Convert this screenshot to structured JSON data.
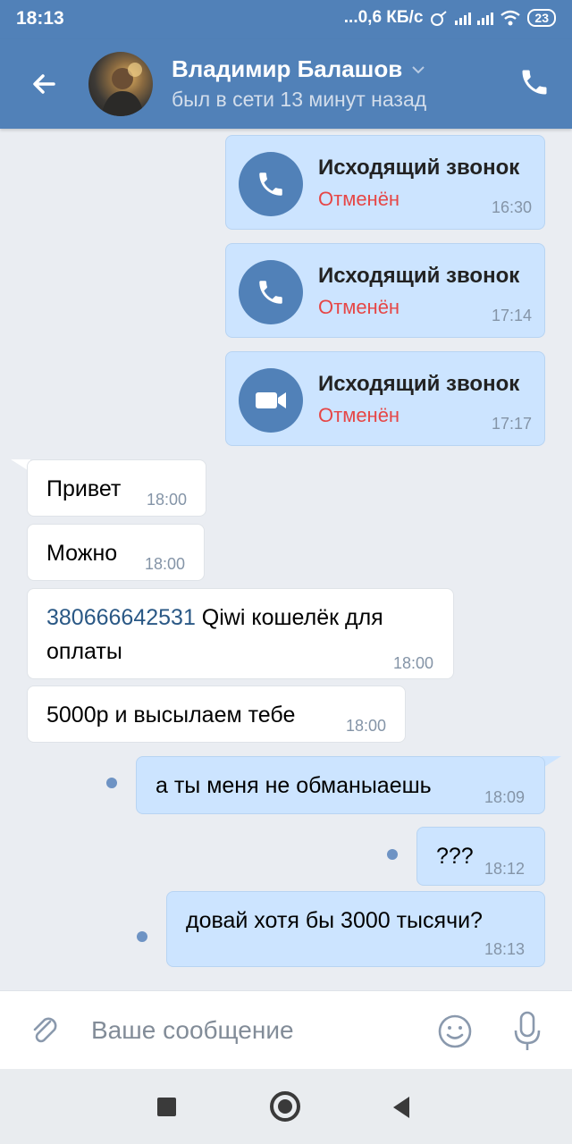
{
  "status_bar": {
    "time": "18:13",
    "network_speed": "...0,6 КБ/с",
    "battery": "23"
  },
  "header": {
    "name": "Владимир Балашов",
    "status": "был в сети 13 минут назад"
  },
  "calls": [
    {
      "title": "Исходящий звонок",
      "status": "Отменён",
      "time": "16:30",
      "icon": "phone-icon"
    },
    {
      "title": "Исходящий звонок",
      "status": "Отменён",
      "time": "17:14",
      "icon": "phone-icon"
    },
    {
      "title": "Исходящий звонок",
      "status": "Отменён",
      "time": "17:17",
      "icon": "video-camera-icon"
    }
  ],
  "messages": [
    {
      "dir": "in",
      "text": "Привет",
      "time": "18:00"
    },
    {
      "dir": "in",
      "text": "Можно",
      "time": "18:00"
    },
    {
      "dir": "in",
      "link": "380666642531",
      "text": " Qiwi кошелёк для",
      "text2": "оплаты",
      "time": "18:00"
    },
    {
      "dir": "in",
      "text": "5000р и высылаем тебе",
      "time": "18:00"
    },
    {
      "dir": "out",
      "text": "а ты меня не обманыаешь",
      "time": "18:09"
    },
    {
      "dir": "out",
      "text": "???",
      "time": "18:12"
    },
    {
      "dir": "out",
      "text": "довай хотя бы 3000 тысячи?",
      "time": "18:13"
    }
  ],
  "composer": {
    "placeholder": "Ваше сообщение"
  },
  "colors": {
    "accent": "#5181b8",
    "outgoing_bubble": "#cce4ff",
    "cancelled": "#e64646"
  }
}
